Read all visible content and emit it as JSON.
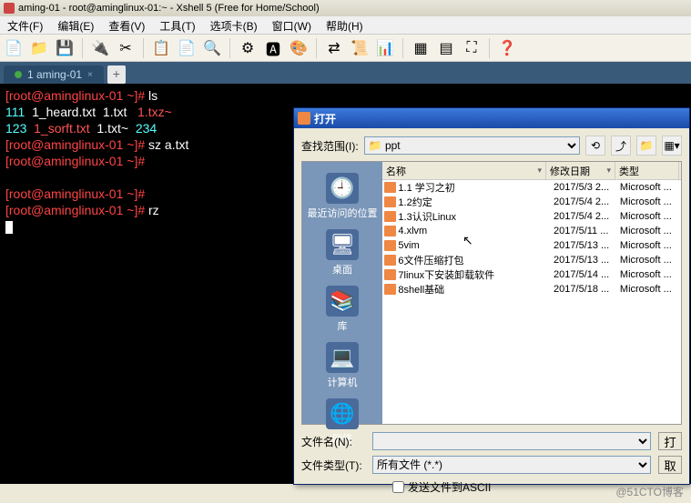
{
  "window_title": "aming-01 - root@aminglinux-01:~ - Xshell 5 (Free for Home/School)",
  "menu": [
    "文件(F)",
    "编辑(E)",
    "查看(V)",
    "工具(T)",
    "选项卡(B)",
    "窗口(W)",
    "帮助(H)"
  ],
  "tab": {
    "label": "1 aming-01",
    "close": "×"
  },
  "terminal": {
    "l1p": "[root@aminglinux-01 ~]#",
    "l1c": " ls",
    "l2a": "111",
    "l2b": "1_heard.txt",
    "l2c": "1.txt",
    "l2d": "1.txz~",
    "l3a": "123",
    "l3b": "1_sorft.txt",
    "l3c": "1.txt~",
    "l3d": "234",
    "l4p": "[root@aminglinux-01 ~]#",
    "l4c": " sz a.txt",
    "l5p": "[root@aminglinux-01 ~]#",
    "l6p": "[root@aminglinux-01 ~]#",
    "l7p": "[root@aminglinux-01 ~]#",
    "l7c": " rz"
  },
  "dialog": {
    "title": "打开",
    "look_label": "查找范围(I):",
    "look_value": "ppt",
    "cols": {
      "name": "名称",
      "date": "修改日期",
      "type": "类型"
    },
    "places": [
      "最近访问的位置",
      "桌面",
      "库",
      "计算机",
      "网络"
    ],
    "files": [
      {
        "n": "1.1 学习之初",
        "d": "2017/5/3 2...",
        "t": "Microsoft ..."
      },
      {
        "n": "1.2约定",
        "d": "2017/5/4 2...",
        "t": "Microsoft ..."
      },
      {
        "n": "1.3认识Linux",
        "d": "2017/5/4 2...",
        "t": "Microsoft ..."
      },
      {
        "n": "4.xlvm",
        "d": "2017/5/11 ...",
        "t": "Microsoft ..."
      },
      {
        "n": "5vim",
        "d": "2017/5/13 ...",
        "t": "Microsoft ..."
      },
      {
        "n": "6文件压缩打包",
        "d": "2017/5/13 ...",
        "t": "Microsoft ..."
      },
      {
        "n": "7linux下安装卸载软件",
        "d": "2017/5/14 ...",
        "t": "Microsoft ..."
      },
      {
        "n": "8shell基础",
        "d": "2017/5/18 ...",
        "t": "Microsoft ..."
      }
    ],
    "filename_label": "文件名(N):",
    "filetype_label": "文件类型(T):",
    "filetype_value": "所有文件 (*.*)",
    "ascii_label": "发送文件到ASCII"
  },
  "watermark": "@51CTO博客"
}
